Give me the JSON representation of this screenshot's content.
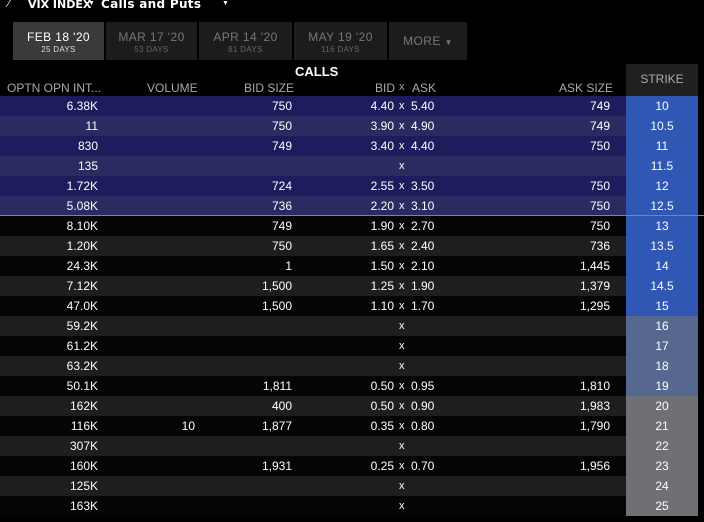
{
  "topbar": {
    "symbol": "VIX INDEX",
    "title": "Calls and Puts"
  },
  "tabs": [
    {
      "label": "FEB 18 '20",
      "days": "25 DAYS",
      "active": true
    },
    {
      "label": "MAR 17 '20",
      "days": "53 DAYS",
      "active": false
    },
    {
      "label": "APR 14 '20",
      "days": "81 DAYS",
      "active": false
    },
    {
      "label": "MAY 19 '20",
      "days": "116 DAYS",
      "active": false
    },
    {
      "label": "MORE",
      "days": "",
      "active": false
    }
  ],
  "header": {
    "section": "CALLS",
    "columns": {
      "oi": "OPTN OPN INT...",
      "volume": "VOLUME",
      "bid_size": "BID SIZE",
      "bid": "BID",
      "x": "x",
      "ask": "ASK",
      "ask_size": "ASK SIZE",
      "strike": "STRIKE"
    }
  },
  "colors": {
    "itm_dark": "#1d1d5e",
    "itm_light": "#2b2b62",
    "row_dark": "#050505",
    "row_light": "#1e1e1e",
    "strike_itm": "#2f57b3",
    "strike_mid": "#56688f",
    "strike_otm": "#6e7074"
  },
  "rows": [
    {
      "oi": "6.38K",
      "volume": "",
      "bid_size": "750",
      "bid": "4.40",
      "x": "x",
      "ask": "5.40",
      "ask_size": "749",
      "strike": "10"
    },
    {
      "oi": "11",
      "volume": "",
      "bid_size": "750",
      "bid": "3.90",
      "x": "x",
      "ask": "4.90",
      "ask_size": "749",
      "strike": "10.5"
    },
    {
      "oi": "830",
      "volume": "",
      "bid_size": "749",
      "bid": "3.40",
      "x": "x",
      "ask": "4.40",
      "ask_size": "750",
      "strike": "11"
    },
    {
      "oi": "135",
      "volume": "",
      "bid_size": "",
      "bid": "",
      "x": "x",
      "ask": "",
      "ask_size": "",
      "strike": "11.5"
    },
    {
      "oi": "1.72K",
      "volume": "",
      "bid_size": "724",
      "bid": "2.55",
      "x": "x",
      "ask": "3.50",
      "ask_size": "750",
      "strike": "12"
    },
    {
      "oi": "5.08K",
      "volume": "",
      "bid_size": "736",
      "bid": "2.20",
      "x": "x",
      "ask": "3.10",
      "ask_size": "750",
      "strike": "12.5"
    },
    {
      "oi": "8.10K",
      "volume": "",
      "bid_size": "749",
      "bid": "1.90",
      "x": "x",
      "ask": "2.70",
      "ask_size": "750",
      "strike": "13"
    },
    {
      "oi": "1.20K",
      "volume": "",
      "bid_size": "750",
      "bid": "1.65",
      "x": "x",
      "ask": "2.40",
      "ask_size": "736",
      "strike": "13.5"
    },
    {
      "oi": "24.3K",
      "volume": "",
      "bid_size": "1",
      "bid": "1.50",
      "x": "x",
      "ask": "2.10",
      "ask_size": "1,445",
      "strike": "14"
    },
    {
      "oi": "7.12K",
      "volume": "",
      "bid_size": "1,500",
      "bid": "1.25",
      "x": "x",
      "ask": "1.90",
      "ask_size": "1,379",
      "strike": "14.5"
    },
    {
      "oi": "47.0K",
      "volume": "",
      "bid_size": "1,500",
      "bid": "1.10",
      "x": "x",
      "ask": "1.70",
      "ask_size": "1,295",
      "strike": "15"
    },
    {
      "oi": "59.2K",
      "volume": "",
      "bid_size": "",
      "bid": "",
      "x": "x",
      "ask": "",
      "ask_size": "",
      "strike": "16"
    },
    {
      "oi": "61.2K",
      "volume": "",
      "bid_size": "",
      "bid": "",
      "x": "x",
      "ask": "",
      "ask_size": "",
      "strike": "17"
    },
    {
      "oi": "63.2K",
      "volume": "",
      "bid_size": "",
      "bid": "",
      "x": "x",
      "ask": "",
      "ask_size": "",
      "strike": "18"
    },
    {
      "oi": "50.1K",
      "volume": "",
      "bid_size": "1,811",
      "bid": "0.50",
      "x": "x",
      "ask": "0.95",
      "ask_size": "1,810",
      "strike": "19"
    },
    {
      "oi": "162K",
      "volume": "",
      "bid_size": "400",
      "bid": "0.50",
      "x": "x",
      "ask": "0.90",
      "ask_size": "1,983",
      "strike": "20"
    },
    {
      "oi": "116K",
      "volume": "10",
      "bid_size": "1,877",
      "bid": "0.35",
      "x": "x",
      "ask": "0.80",
      "ask_size": "1,790",
      "strike": "21"
    },
    {
      "oi": "307K",
      "volume": "",
      "bid_size": "",
      "bid": "",
      "x": "x",
      "ask": "",
      "ask_size": "",
      "strike": "22"
    },
    {
      "oi": "160K",
      "volume": "",
      "bid_size": "1,931",
      "bid": "0.25",
      "x": "x",
      "ask": "0.70",
      "ask_size": "1,956",
      "strike": "23"
    },
    {
      "oi": "125K",
      "volume": "",
      "bid_size": "",
      "bid": "",
      "x": "x",
      "ask": "",
      "ask_size": "",
      "strike": "24"
    },
    {
      "oi": "163K",
      "volume": "",
      "bid_size": "",
      "bid": "",
      "x": "x",
      "ask": "",
      "ask_size": "",
      "strike": "25"
    }
  ]
}
